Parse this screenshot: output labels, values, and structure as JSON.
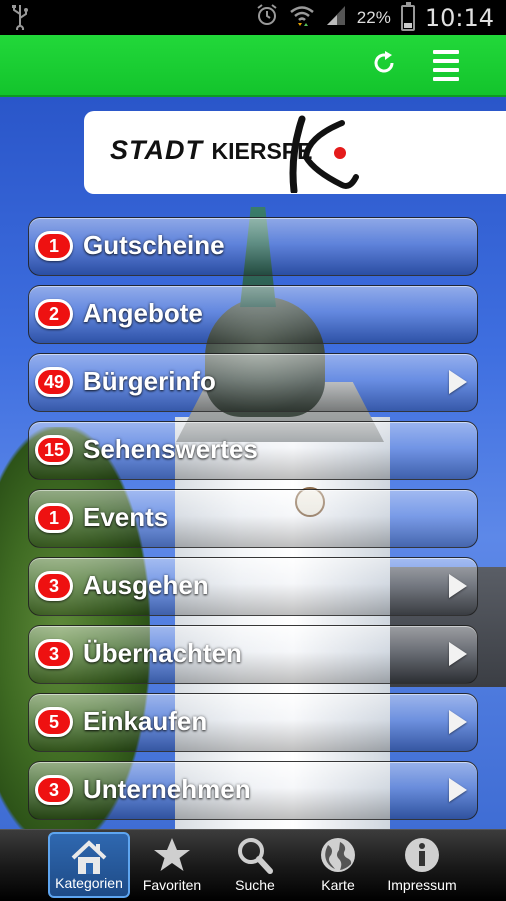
{
  "status_bar": {
    "battery_percent": "22%",
    "battery_level": 0.22,
    "time": "10:14",
    "icons": [
      "usb-icon",
      "alarm-icon",
      "wifi-icon",
      "signal-icon",
      "battery-charging-icon"
    ]
  },
  "action_bar": {
    "color": "#1cd134",
    "icons": [
      "refresh-icon",
      "menu-icon"
    ]
  },
  "logo": {
    "text_bold": "STADT",
    "text_small": "KIERSPE"
  },
  "menu": {
    "items": [
      {
        "count": "1",
        "label": "Gutscheine",
        "has_arrow": false
      },
      {
        "count": "2",
        "label": "Angebote",
        "has_arrow": false
      },
      {
        "count": "49",
        "label": "Bürgerinfo",
        "has_arrow": true
      },
      {
        "count": "15",
        "label": "Sehenswertes",
        "has_arrow": false
      },
      {
        "count": "1",
        "label": "Events",
        "has_arrow": false
      },
      {
        "count": "3",
        "label": "Ausgehen",
        "has_arrow": true
      },
      {
        "count": "3",
        "label": "Übernachten",
        "has_arrow": true
      },
      {
        "count": "5",
        "label": "Einkaufen",
        "has_arrow": true
      },
      {
        "count": "3",
        "label": "Unternehmen",
        "has_arrow": true
      }
    ],
    "badge_color": "#ee1111"
  },
  "tab_bar": {
    "tabs": [
      {
        "label": "Kategorien",
        "icon": "home-icon",
        "active": true
      },
      {
        "label": "Favoriten",
        "icon": "star-icon",
        "active": false
      },
      {
        "label": "Suche",
        "icon": "search-icon",
        "active": false
      },
      {
        "label": "Karte",
        "icon": "globe-icon",
        "active": false
      },
      {
        "label": "Impressum",
        "icon": "info-icon",
        "active": false
      }
    ],
    "active_color": "#2f68b0"
  }
}
